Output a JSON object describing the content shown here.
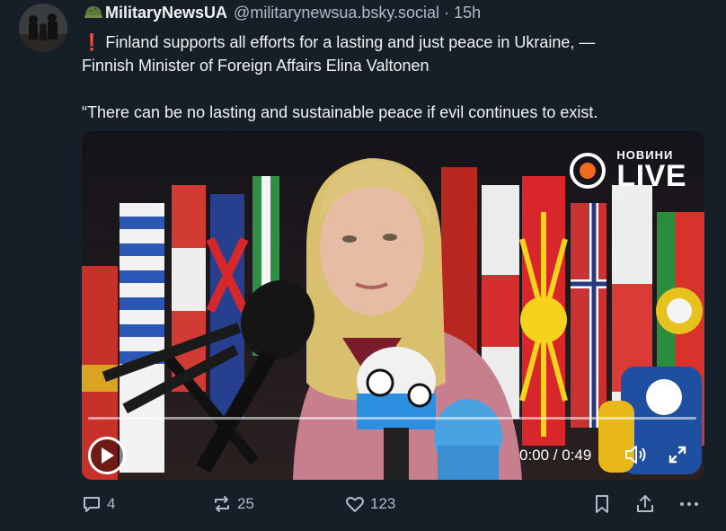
{
  "post": {
    "display_name": "MilitaryNewsUA",
    "display_name_suffix": "UA",
    "handle": "@militarynewsua.bsky.social",
    "separator": "·",
    "time": "15h",
    "exclamation": "❗",
    "line1": "Finland supports all efforts for a lasting and just peace in Ukraine, —",
    "line2": "Finnish Minister of Foreign Affairs Elina Valtonen",
    "line3": "“There can be no lasting and sustainable peace if evil continues to exist."
  },
  "video": {
    "badge_small": "НОВИНИ",
    "badge_big": "LIVE",
    "time_display": "0:00 / 0:49",
    "progress": 0,
    "badge_color": "#f06a1d"
  },
  "actions": {
    "replies": "4",
    "reposts": "25",
    "likes": "123"
  },
  "icons": [
    "helmet-icon",
    "play-icon",
    "volume-icon",
    "fullscreen-icon",
    "reply-icon",
    "repost-icon",
    "like-icon",
    "bookmark-icon",
    "share-icon",
    "more-icon"
  ]
}
